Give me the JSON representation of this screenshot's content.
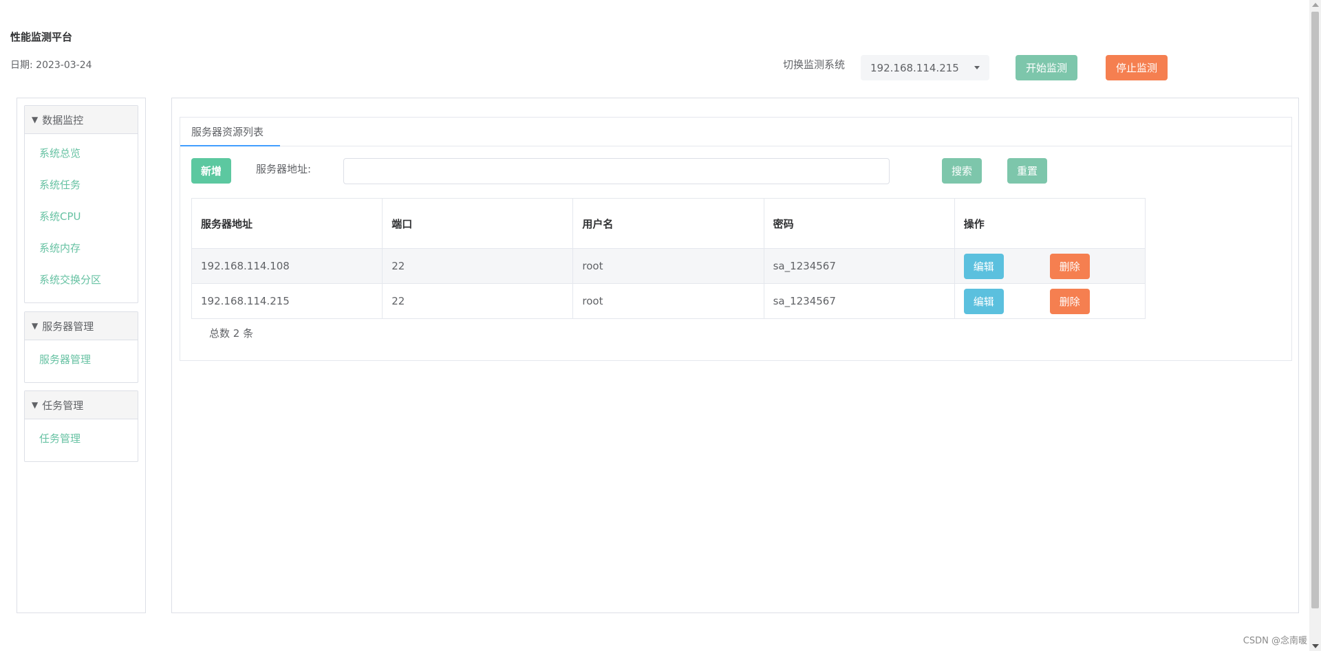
{
  "header": {
    "title": "性能监测平台",
    "date": "日期: 2023-03-24",
    "switch_label": "切换监测系统",
    "selected_system": "192.168.114.215",
    "start_label": "开始监测",
    "stop_label": "停止监测"
  },
  "sidebar": {
    "groups": [
      {
        "title": "数据监控",
        "items": [
          "系统总览",
          "系统任务",
          "系统CPU",
          "系统内存",
          "系统交换分区"
        ]
      },
      {
        "title": "服务器管理",
        "items": [
          "服务器管理"
        ]
      },
      {
        "title": "任务管理",
        "items": [
          "任务管理"
        ]
      }
    ],
    "toggle_glyph": "▼"
  },
  "main": {
    "tab_label": "服务器资源列表",
    "add_label": "新增",
    "address_label": "服务器地址:",
    "address_value": "",
    "search_label": "搜索",
    "reset_label": "重置",
    "table": {
      "headers": [
        "服务器地址",
        "端口",
        "用户名",
        "密码",
        "操作"
      ],
      "rows": [
        {
          "address": "192.168.114.108",
          "port": "22",
          "username": "root",
          "password": "sa_1234567"
        },
        {
          "address": "192.168.114.215",
          "port": "22",
          "username": "root",
          "password": "sa_1234567"
        }
      ],
      "edit_label": "编辑",
      "delete_label": "删除"
    },
    "total": "总数 2 条"
  },
  "watermark": "CSDN @念南暖",
  "colors": {
    "green_button": "#7dc6ab",
    "add_button": "#5cc8a0",
    "orange_button": "#f57f50",
    "edit_button": "#5bc0de",
    "menu_link": "#67c2a3",
    "tab_underline": "#409eff"
  }
}
